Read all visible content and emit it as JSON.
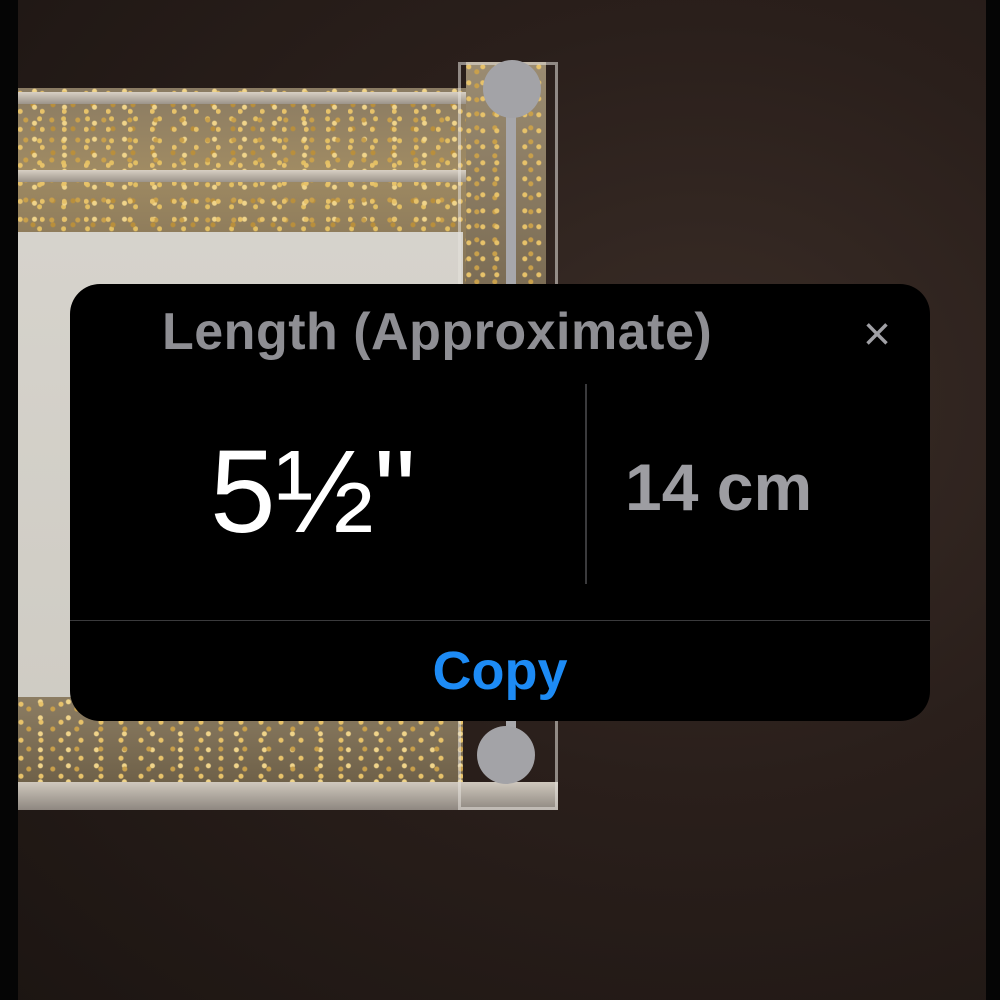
{
  "measurement_card": {
    "title": "Length (Approximate)",
    "close_icon": "close-icon",
    "close_glyph": "×",
    "primary_value": "5½\"",
    "secondary_value": "14 cm",
    "copy_label": "Copy"
  },
  "colors": {
    "title": "#8e8e93",
    "primary_value": "#ffffff",
    "secondary_value": "#9d9da2",
    "copy_accent": "#1d8bf5",
    "card_background": "#000000"
  }
}
